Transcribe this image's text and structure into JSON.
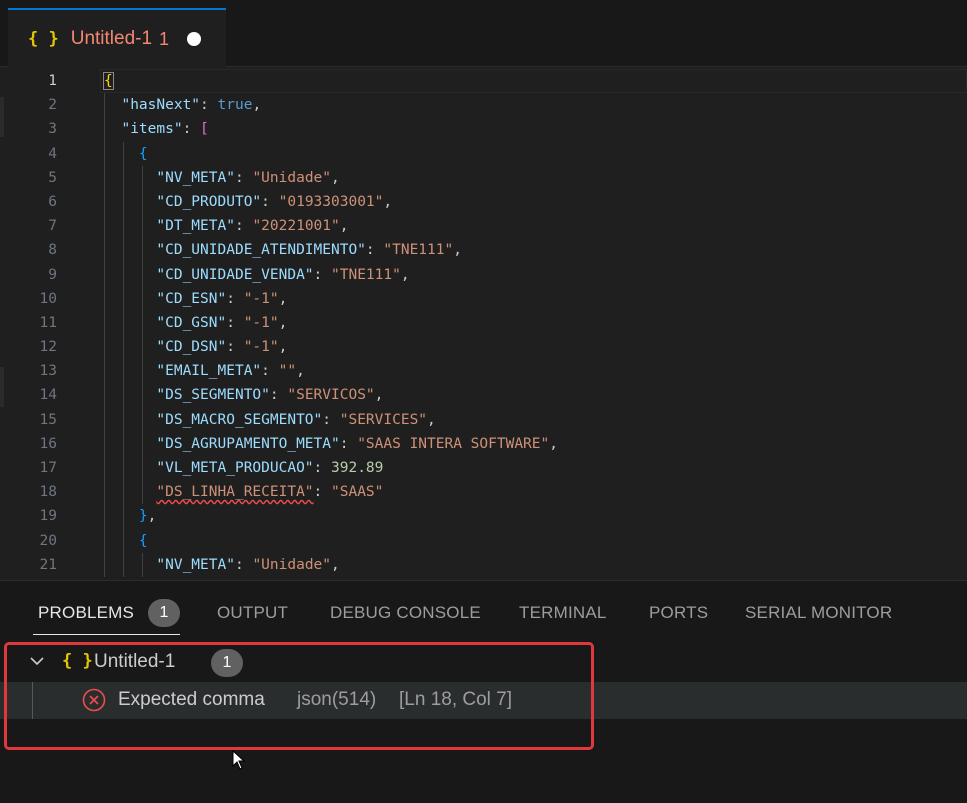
{
  "tab": {
    "icon": "{ }",
    "title": "Untitled-1",
    "problem_count": "1"
  },
  "editor": {
    "active_line": 1,
    "lines": [
      {
        "n": "1",
        "tokens": [
          {
            "t": "{",
            "c": "br1 bracket-match"
          }
        ]
      },
      {
        "n": "2",
        "tokens": [
          {
            "t": "  ",
            "c": "p"
          },
          {
            "t": "\"hasNext\"",
            "c": "k"
          },
          {
            "t": ": ",
            "c": "p"
          },
          {
            "t": "true",
            "c": "b"
          },
          {
            "t": ",",
            "c": "p"
          }
        ]
      },
      {
        "n": "3",
        "tokens": [
          {
            "t": "  ",
            "c": "p"
          },
          {
            "t": "\"items\"",
            "c": "k"
          },
          {
            "t": ": ",
            "c": "p"
          },
          {
            "t": "[",
            "c": "br2"
          }
        ]
      },
      {
        "n": "4",
        "tokens": [
          {
            "t": "    ",
            "c": "p"
          },
          {
            "t": "{",
            "c": "br3"
          }
        ]
      },
      {
        "n": "5",
        "tokens": [
          {
            "t": "      ",
            "c": "p"
          },
          {
            "t": "\"NV_META\"",
            "c": "k"
          },
          {
            "t": ": ",
            "c": "p"
          },
          {
            "t": "\"Unidade\"",
            "c": "s"
          },
          {
            "t": ",",
            "c": "p"
          }
        ]
      },
      {
        "n": "6",
        "tokens": [
          {
            "t": "      ",
            "c": "p"
          },
          {
            "t": "\"CD_PRODUTO\"",
            "c": "k"
          },
          {
            "t": ": ",
            "c": "p"
          },
          {
            "t": "\"0193303001\"",
            "c": "s"
          },
          {
            "t": ",",
            "c": "p"
          }
        ]
      },
      {
        "n": "7",
        "tokens": [
          {
            "t": "      ",
            "c": "p"
          },
          {
            "t": "\"DT_META\"",
            "c": "k"
          },
          {
            "t": ": ",
            "c": "p"
          },
          {
            "t": "\"20221001\"",
            "c": "s"
          },
          {
            "t": ",",
            "c": "p"
          }
        ]
      },
      {
        "n": "8",
        "tokens": [
          {
            "t": "      ",
            "c": "p"
          },
          {
            "t": "\"CD_UNIDADE_ATENDIMENTO\"",
            "c": "k"
          },
          {
            "t": ": ",
            "c": "p"
          },
          {
            "t": "\"TNE111\"",
            "c": "s"
          },
          {
            "t": ",",
            "c": "p"
          }
        ]
      },
      {
        "n": "9",
        "tokens": [
          {
            "t": "      ",
            "c": "p"
          },
          {
            "t": "\"CD_UNIDADE_VENDA\"",
            "c": "k"
          },
          {
            "t": ": ",
            "c": "p"
          },
          {
            "t": "\"TNE111\"",
            "c": "s"
          },
          {
            "t": ",",
            "c": "p"
          }
        ]
      },
      {
        "n": "10",
        "tokens": [
          {
            "t": "      ",
            "c": "p"
          },
          {
            "t": "\"CD_ESN\"",
            "c": "k"
          },
          {
            "t": ": ",
            "c": "p"
          },
          {
            "t": "\"-1\"",
            "c": "s"
          },
          {
            "t": ",",
            "c": "p"
          }
        ]
      },
      {
        "n": "11",
        "tokens": [
          {
            "t": "      ",
            "c": "p"
          },
          {
            "t": "\"CD_GSN\"",
            "c": "k"
          },
          {
            "t": ": ",
            "c": "p"
          },
          {
            "t": "\"-1\"",
            "c": "s"
          },
          {
            "t": ",",
            "c": "p"
          }
        ]
      },
      {
        "n": "12",
        "tokens": [
          {
            "t": "      ",
            "c": "p"
          },
          {
            "t": "\"CD_DSN\"",
            "c": "k"
          },
          {
            "t": ": ",
            "c": "p"
          },
          {
            "t": "\"-1\"",
            "c": "s"
          },
          {
            "t": ",",
            "c": "p"
          }
        ]
      },
      {
        "n": "13",
        "tokens": [
          {
            "t": "      ",
            "c": "p"
          },
          {
            "t": "\"EMAIL_META\"",
            "c": "k"
          },
          {
            "t": ": ",
            "c": "p"
          },
          {
            "t": "\"\"",
            "c": "s"
          },
          {
            "t": ",",
            "c": "p"
          }
        ]
      },
      {
        "n": "14",
        "tokens": [
          {
            "t": "      ",
            "c": "p"
          },
          {
            "t": "\"DS_SEGMENTO\"",
            "c": "k"
          },
          {
            "t": ": ",
            "c": "p"
          },
          {
            "t": "\"SERVICOS\"",
            "c": "s"
          },
          {
            "t": ",",
            "c": "p"
          }
        ]
      },
      {
        "n": "15",
        "tokens": [
          {
            "t": "      ",
            "c": "p"
          },
          {
            "t": "\"DS_MACRO_SEGMENTO\"",
            "c": "k"
          },
          {
            "t": ": ",
            "c": "p"
          },
          {
            "t": "\"SERVICES\"",
            "c": "s"
          },
          {
            "t": ",",
            "c": "p"
          }
        ]
      },
      {
        "n": "16",
        "tokens": [
          {
            "t": "      ",
            "c": "p"
          },
          {
            "t": "\"DS_AGRUPAMENTO_META\"",
            "c": "k"
          },
          {
            "t": ": ",
            "c": "p"
          },
          {
            "t": "\"SAAS INTERA SOFTWARE\"",
            "c": "s"
          },
          {
            "t": ",",
            "c": "p"
          }
        ]
      },
      {
        "n": "17",
        "tokens": [
          {
            "t": "      ",
            "c": "p"
          },
          {
            "t": "\"VL_META_PRODUCAO\"",
            "c": "k"
          },
          {
            "t": ": ",
            "c": "p"
          },
          {
            "t": "392.89",
            "c": "n"
          }
        ]
      },
      {
        "n": "18",
        "tokens": [
          {
            "t": "      ",
            "c": "p"
          },
          {
            "t": "\"DS_LINHA_RECEITA\"",
            "c": "s err"
          },
          {
            "t": ": ",
            "c": "p"
          },
          {
            "t": "\"SAAS\"",
            "c": "s"
          }
        ]
      },
      {
        "n": "19",
        "tokens": [
          {
            "t": "    ",
            "c": "p"
          },
          {
            "t": "}",
            "c": "br3"
          },
          {
            "t": ",",
            "c": "p"
          }
        ]
      },
      {
        "n": "20",
        "tokens": [
          {
            "t": "    ",
            "c": "p"
          },
          {
            "t": "{",
            "c": "br3"
          }
        ]
      },
      {
        "n": "21",
        "tokens": [
          {
            "t": "      ",
            "c": "p"
          },
          {
            "t": "\"NV_META\"",
            "c": "k"
          },
          {
            "t": ": ",
            "c": "p"
          },
          {
            "t": "\"Unidade\"",
            "c": "s"
          },
          {
            "t": ",",
            "c": "p"
          }
        ]
      }
    ]
  },
  "panel": {
    "tabs": [
      "PROBLEMS",
      "OUTPUT",
      "DEBUG CONSOLE",
      "TERMINAL",
      "PORTS",
      "SERIAL MONITOR"
    ],
    "problems_badge": "1",
    "file": {
      "icon": "{ }",
      "name": "Untitled-1",
      "count": "1"
    },
    "error": {
      "message": "Expected comma",
      "source": "json(514)",
      "location": "[Ln 18, Col 7]"
    }
  },
  "colors": {
    "accent": "#0078d4",
    "error": "#f14c4c",
    "highlight_box": "#e0383c"
  }
}
